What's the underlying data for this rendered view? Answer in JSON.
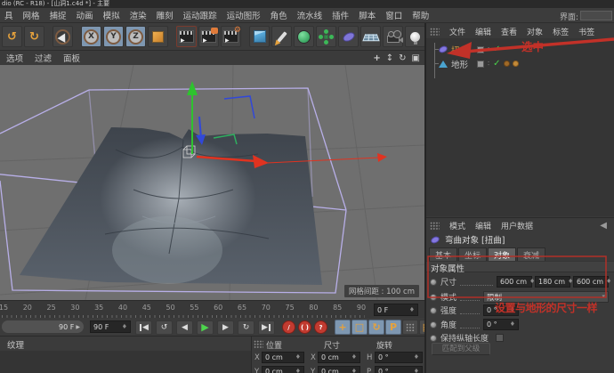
{
  "window": {
    "title": "dio (RC - R18) - [山洞1.c4d *] - 主要",
    "interface_label": "界面:"
  },
  "menu_bar": {
    "items": [
      "具",
      "网格",
      "捕捉",
      "动画",
      "模拟",
      "渲染",
      "雕刻",
      "运动跟踪",
      "运动图形",
      "角色",
      "流水线",
      "插件",
      "脚本",
      "窗口",
      "帮助"
    ]
  },
  "toolbar": {
    "axis_locks": [
      "X",
      "Y",
      "Z"
    ]
  },
  "viewport": {
    "menu_items": [
      "选项",
      "过滤",
      "面板"
    ],
    "grid_spacing_label": "网格间距 : 100 cm"
  },
  "object_manager": {
    "menu_items": [
      "文件",
      "编辑",
      "查看",
      "对象",
      "标签",
      "书签"
    ],
    "objects": [
      {
        "name": "扭曲"
      },
      {
        "name": "地形"
      }
    ],
    "annotation_selected": "选中"
  },
  "attribute_manager": {
    "menu_items": [
      "模式",
      "编辑",
      "用户数据"
    ],
    "object_title": "弯曲对象 [扭曲]",
    "tabs": [
      "基本",
      "坐标",
      "对象",
      "衰减"
    ],
    "active_tab": "对象",
    "section_title": "对象属性",
    "size_label": "尺寸",
    "size_values": [
      "600 cm",
      "180 cm",
      "600 cm"
    ],
    "mode_label": "模式",
    "mode_value": "限制",
    "strength_label": "强度",
    "strength_value": "0 °",
    "angle_label": "角度",
    "angle_value": "0 °",
    "keep_axis_label": "保持纵轴长度",
    "match_parent_label": "匹配到父级",
    "annotation_note": "设置与地形的尺寸一样"
  },
  "timeline": {
    "ticks": [
      "15",
      "20",
      "25",
      "30",
      "35",
      "40",
      "45",
      "50",
      "55",
      "60",
      "65",
      "70",
      "75",
      "80",
      "85",
      "90"
    ],
    "offset_field": "0 F",
    "range_end": "90 F",
    "current_frame": "90 F"
  },
  "transport": {
    "p_label": "P",
    "help_label": "?"
  },
  "coordinates": {
    "headers": [
      "位置",
      "尺寸",
      "旋转"
    ],
    "rows": [
      [
        "X",
        "0 cm",
        "X",
        "0 cm",
        "H",
        "0 °"
      ],
      [
        "Y",
        "0 cm",
        "Y",
        "0 cm",
        "P",
        "0 °"
      ]
    ]
  },
  "material_manager": {
    "menu_label": "纹理"
  },
  "colors": {
    "accent_orange": "#e6a23c",
    "highlight_blue": "#7e97b1",
    "annotation_red": "#c23128",
    "check_green": "#4ad04a",
    "axis_green": "#2ec32e",
    "axis_red": "#e03320",
    "axis_blue": "#3148d8",
    "cage_purple": "#b8afe8",
    "terrain_dark": "#49525c"
  }
}
